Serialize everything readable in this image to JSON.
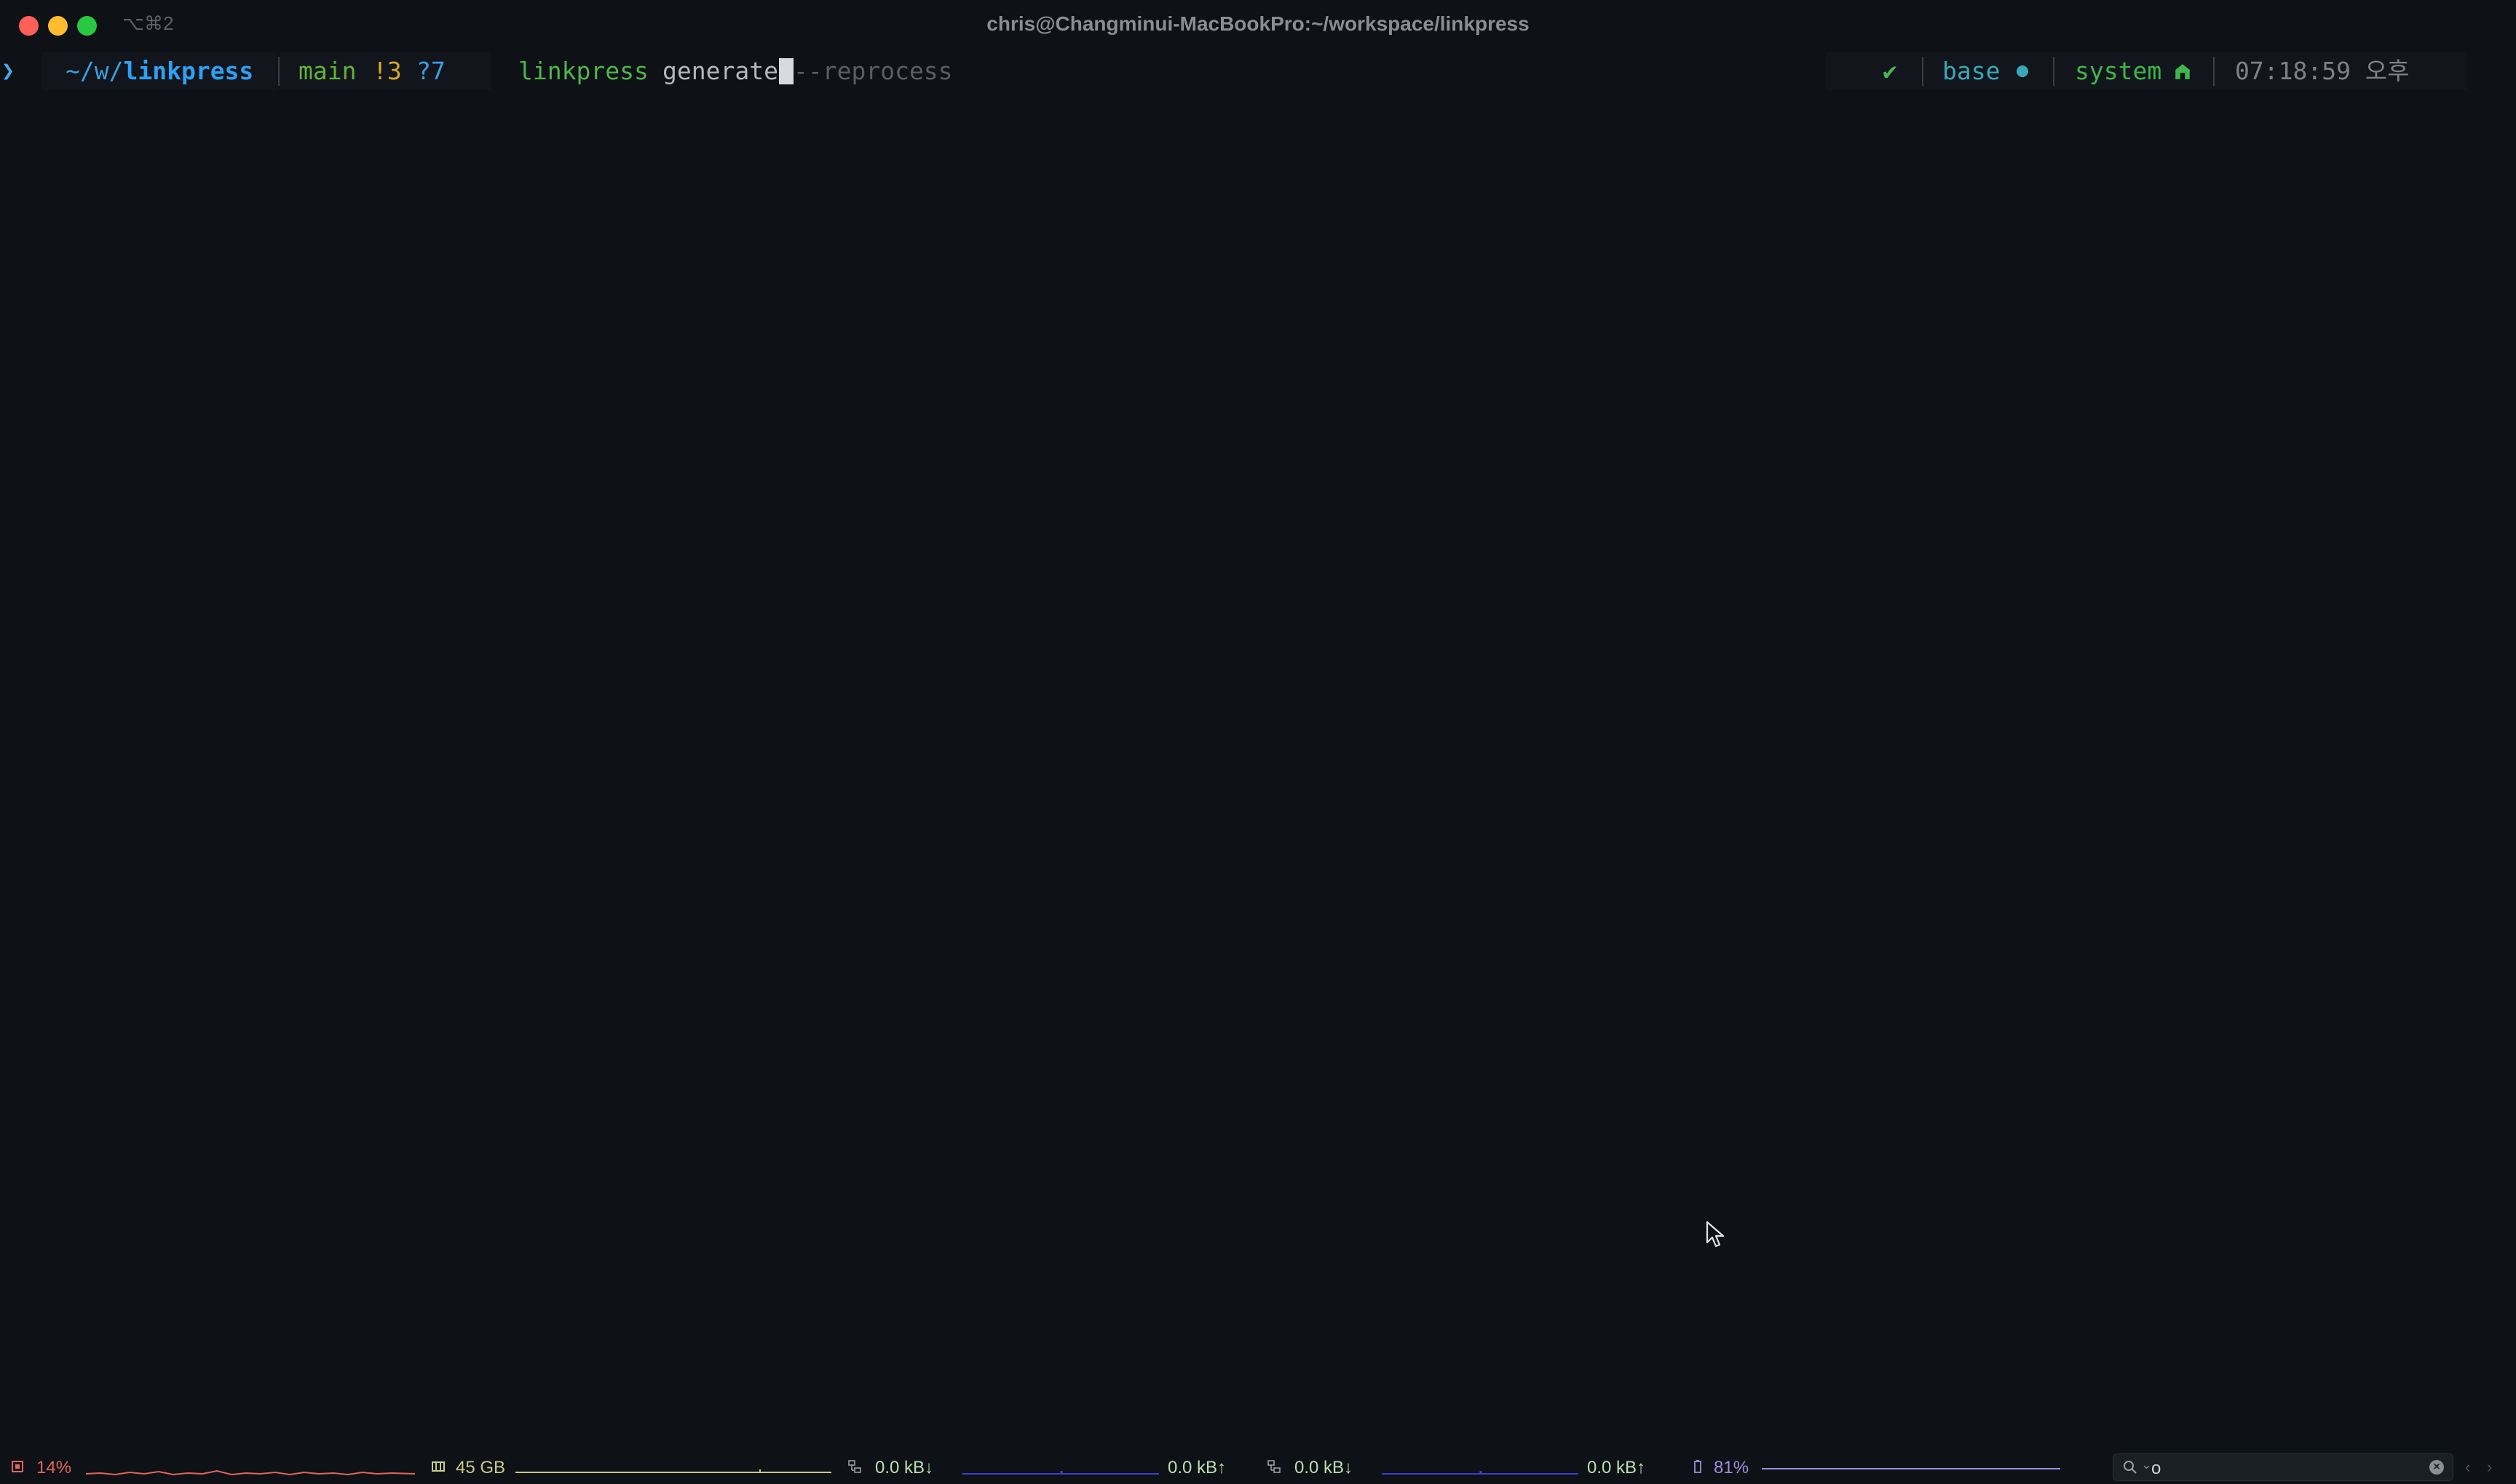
{
  "window": {
    "title": "chris@Changminui-MacBookPro:~/workspace/linkpress",
    "tab_shortcut": "⌥⌘2"
  },
  "prompt": {
    "arrow": "❯",
    "pwd_prefix": "~/w/",
    "pwd_dir": "linkpress",
    "git_branch": "main",
    "git_modified": "!3",
    "git_untracked": "?7",
    "command_name": "linkpress",
    "command_arg": "generate",
    "autosuggestion": "--reprocess",
    "status_ok": "✔",
    "conda_env": "base",
    "node_env": "system",
    "time": "07:18:59 오후"
  },
  "statusbar": {
    "cpu": "14%",
    "memory": "45 GB",
    "net1_down": "0.0 kB↓",
    "net1_up": "0.0 kB↑",
    "net2_down": "0.0 kB↓",
    "net2_up": "0.0 kB↑",
    "battery": "81%",
    "search_value": "o",
    "nav_prev": "‹",
    "nav_next": "›"
  },
  "colors": {
    "background": "#0e1116",
    "path_blue": "#2fa0f3",
    "git_green": "#5fb33a",
    "git_yellow": "#d6a72d",
    "command_green": "#4fb54a",
    "cpu_red": "#e0655b",
    "mem_khaki": "#c9c98a",
    "net_blue": "#3f3fd8",
    "battery_purple": "#a08ce0"
  }
}
